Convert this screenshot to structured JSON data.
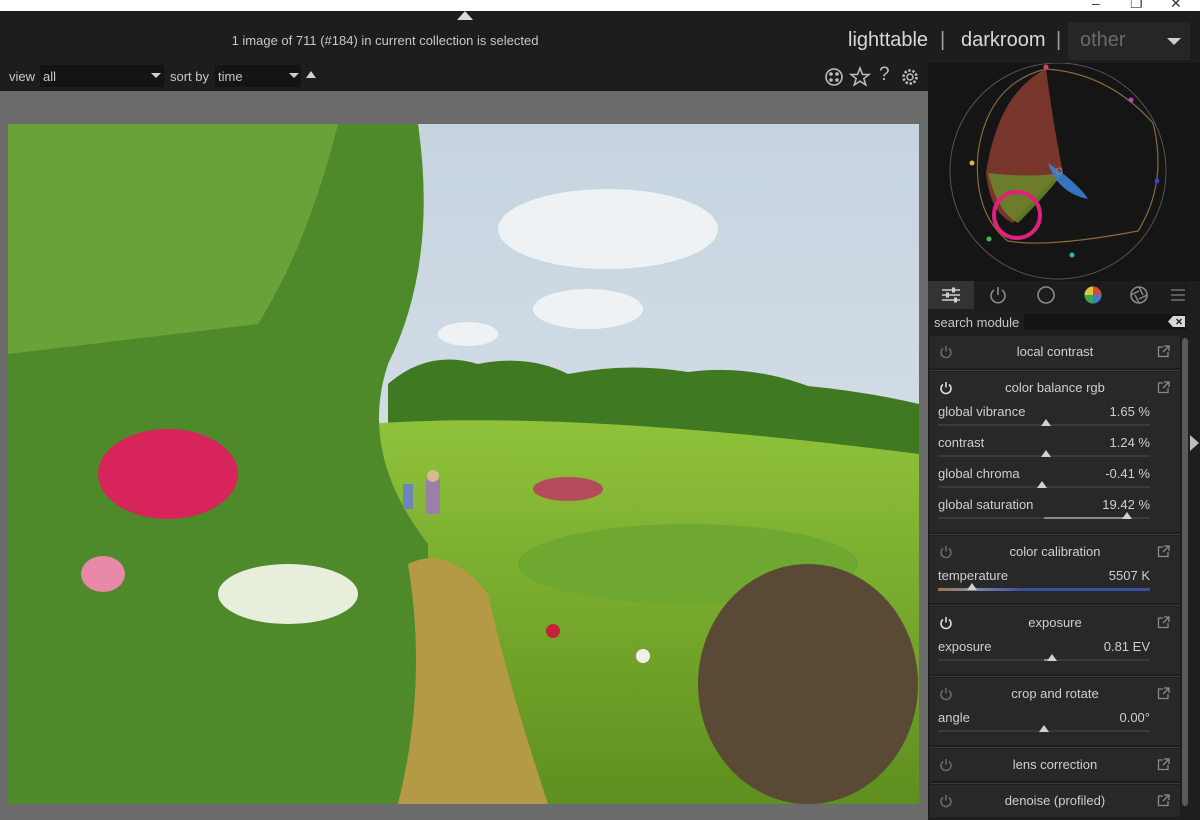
{
  "window": {
    "controls": [
      "–",
      "❐",
      "✕"
    ]
  },
  "header": {
    "status_text": "1 image of 711 (#184) in current collection is selected",
    "views": {
      "lighttable": "lighttable",
      "darkroom": "darkroom",
      "other": "other",
      "separator": "|"
    }
  },
  "filterbar": {
    "view_label": "view",
    "view_value": "all",
    "sort_label": "sort by",
    "sort_value": "time",
    "icons": [
      "presets-icon",
      "star-icon",
      "help-icon",
      "gear-icon"
    ],
    "help_glyph": "?"
  },
  "photo": {
    "description_icon": "image-canvas"
  },
  "scope": {
    "type": "vectorscope"
  },
  "module_tabs": [
    "sliders-icon",
    "power-icon",
    "circle-icon",
    "color-wheel-icon",
    "aperture-icon",
    "menu-icon"
  ],
  "search": {
    "label": "search module",
    "placeholder": ""
  },
  "modules": [
    {
      "title": "local contrast",
      "enabled": false,
      "sliders": []
    },
    {
      "title": "color balance rgb",
      "enabled": true,
      "sliders": [
        {
          "label": "global vibrance",
          "value": "1.65 %",
          "position": 0.51
        },
        {
          "label": "contrast",
          "value": "1.24 %",
          "position": 0.51
        },
        {
          "label": "global chroma",
          "value": "-0.41 %",
          "position": 0.49
        },
        {
          "label": "global saturation",
          "value": "19.42 %",
          "position": 0.89
        }
      ]
    },
    {
      "title": "color calibration",
      "enabled": false,
      "sliders": [
        {
          "label": "temperature",
          "value": "5507 K",
          "position": 0.16
        }
      ]
    },
    {
      "title": "exposure",
      "enabled": true,
      "sliders": [
        {
          "label": "exposure",
          "value": "0.81 EV",
          "position": 0.54
        }
      ]
    },
    {
      "title": "crop and rotate",
      "enabled": false,
      "sliders": [
        {
          "label": "angle",
          "value": "0.00°",
          "position": 0.5
        }
      ]
    },
    {
      "title": "lens correction",
      "enabled": false,
      "sliders": []
    },
    {
      "title": "denoise (profiled)",
      "enabled": false,
      "sliders": []
    }
  ],
  "colors": {
    "accent_magenta": "#e0207a",
    "temperature_blue": "#3a4fa0",
    "panel_bg": "#1e1e1e"
  }
}
